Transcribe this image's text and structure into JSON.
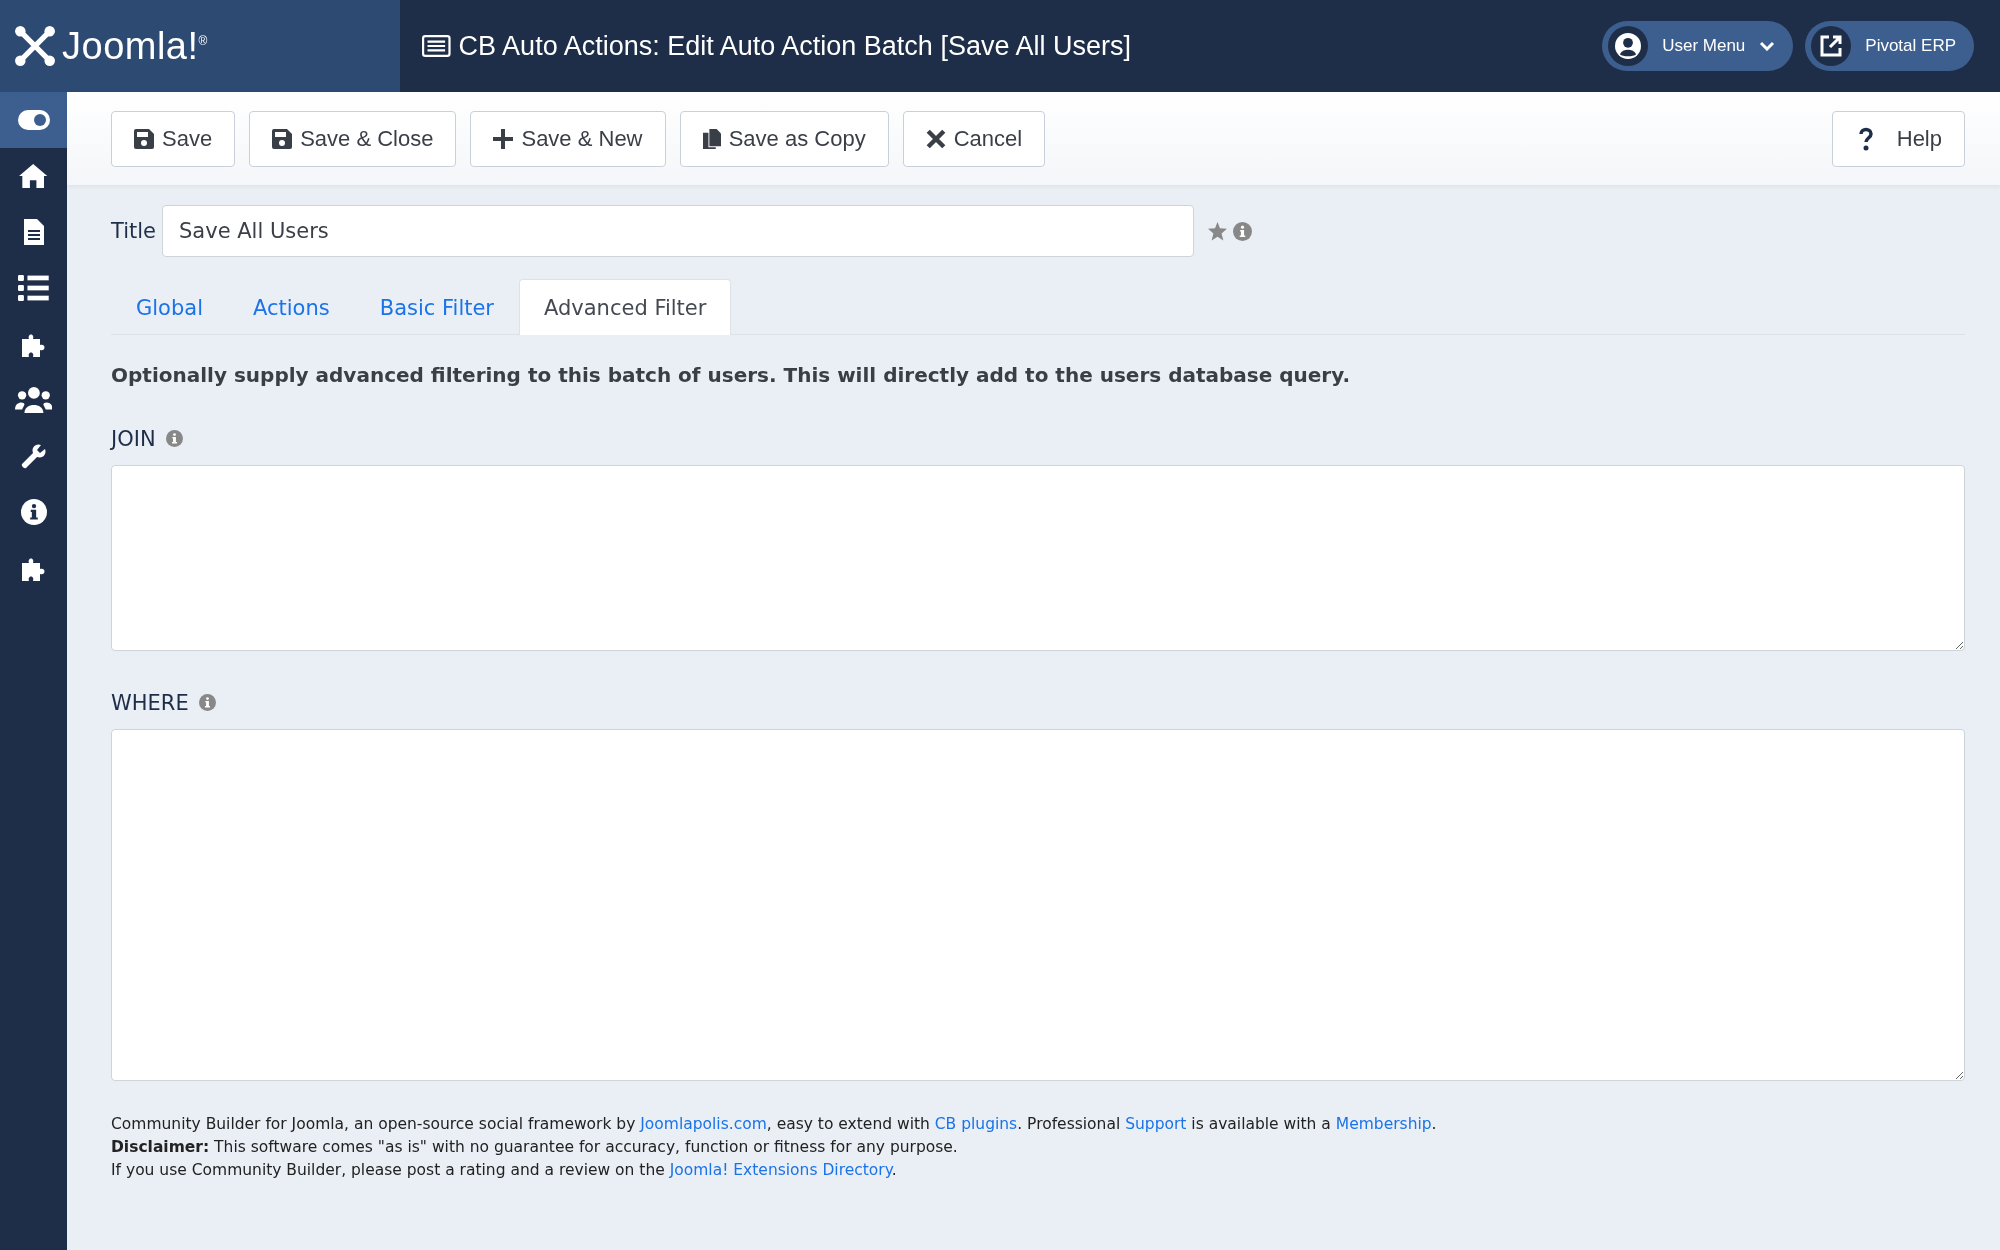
{
  "header": {
    "logo_text": "Joomla!$^{®}$",
    "title": "CB Auto Actions: Edit Auto Action Batch [Save All Users]",
    "user_menu": "User Menu",
    "site_link": "Pivotal ERP"
  },
  "sidebar": {
    "items": [
      {
        "kind": "toggle",
        "selected": true
      },
      {
        "kind": "home",
        "selected": false
      },
      {
        "kind": "document",
        "selected": false
      },
      {
        "kind": "list",
        "selected": false
      },
      {
        "kind": "puzzle",
        "selected": false
      },
      {
        "kind": "users",
        "selected": false
      },
      {
        "kind": "wrench",
        "selected": false
      },
      {
        "kind": "info",
        "selected": false
      },
      {
        "kind": "puzzle",
        "selected": false
      }
    ]
  },
  "toolbar": {
    "buttons": [
      {
        "label": "Save",
        "kind": "save"
      },
      {
        "label": "Save & Close",
        "kind": "save"
      },
      {
        "label": "Save & New",
        "kind": "new"
      },
      {
        "label": "Save as Copy",
        "kind": "copy"
      },
      {
        "label": "Cancel",
        "kind": "cancel"
      }
    ],
    "help": "Help"
  },
  "form": {
    "title_label": "Title",
    "title_value": "Save All Users",
    "tabs": [
      {
        "label": "Global",
        "selected": false
      },
      {
        "label": "Actions",
        "selected": false
      },
      {
        "label": "Basic Filter",
        "selected": false
      },
      {
        "label": "Advanced Filter",
        "selected": true
      }
    ],
    "description": "Optionally supply advanced filtering to this batch of users. This will directly add to the users database query.",
    "fields": [
      {
        "label": "JOIN",
        "kind": "short"
      },
      {
        "label": "WHERE",
        "kind": "tall"
      }
    ]
  },
  "footer": {
    "lines": [
      [
        {
          "kind": "text",
          "text": "Community Builder for Joomla, an open-source social framework by "
        },
        {
          "kind": "link",
          "text": "Joomlapolis.com"
        },
        {
          "kind": "text",
          "text": ", easy to extend with "
        },
        {
          "kind": "link",
          "text": "CB plugins"
        },
        {
          "kind": "text",
          "text": ". Professional "
        },
        {
          "kind": "link",
          "text": "Support"
        },
        {
          "kind": "text",
          "text": " is available with a "
        },
        {
          "kind": "link",
          "text": "Membership"
        },
        {
          "kind": "text",
          "text": "."
        }
      ],
      [
        {
          "kind": "text",
          "text": "**Disclaimer:** This software comes \"as is\" with no guarantee for accuracy, function or fitness for any purpose."
        }
      ],
      [
        {
          "kind": "text",
          "text": "If you use Community Builder, please post a rating and a review on the "
        },
        {
          "kind": "link",
          "text": "Joomla! Extensions Directory"
        },
        {
          "kind": "text",
          "text": "."
        }
      ]
    ]
  }
}
